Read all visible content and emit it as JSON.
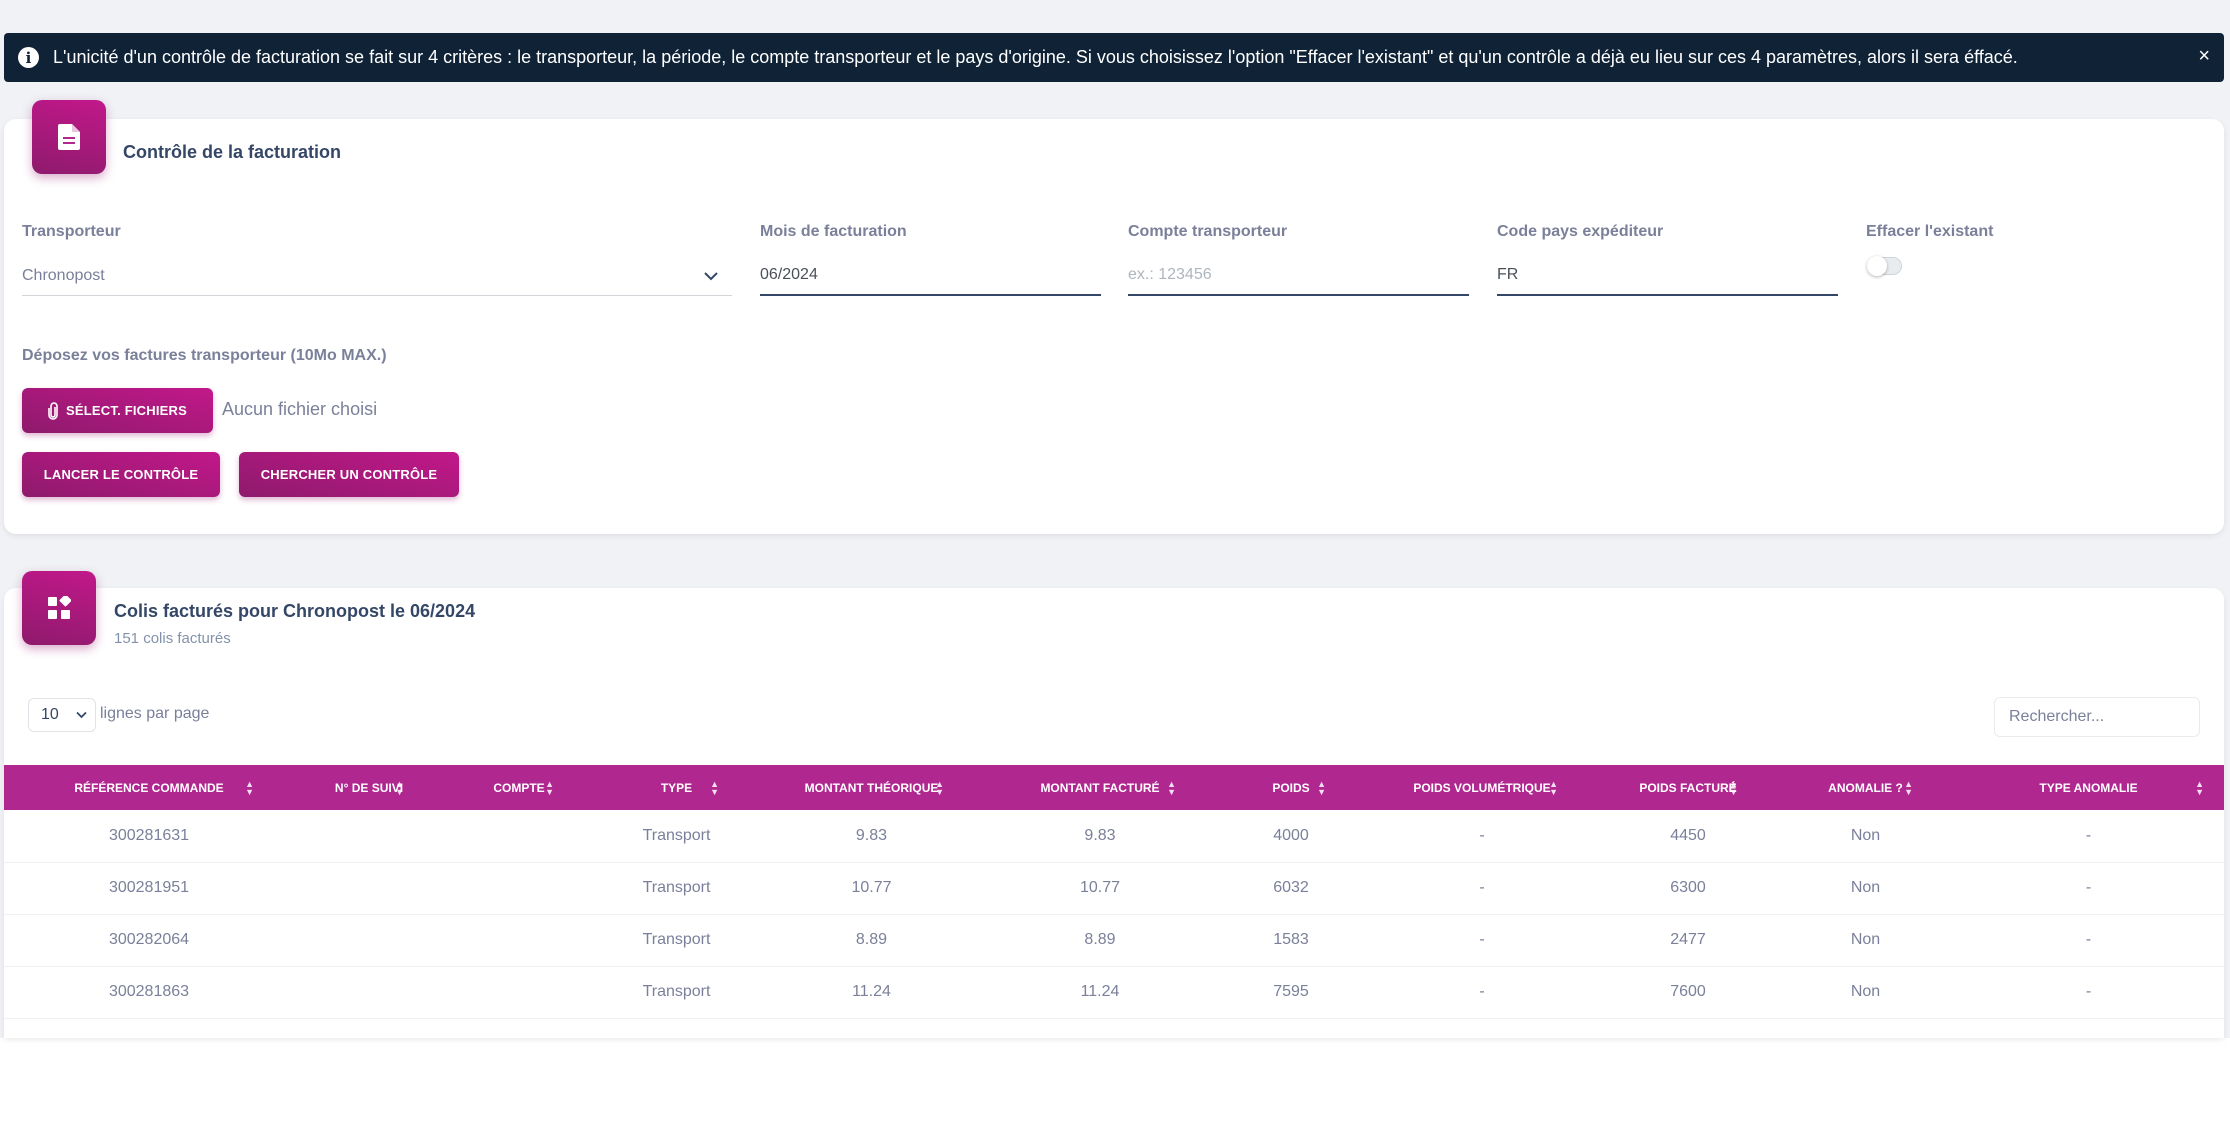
{
  "alert": {
    "text": "L'unicité d'un contrôle de facturation se fait sur 4 critères : le transporteur, la période, le compte transporteur et le pays d'origine. Si vous choisissez l'option \"Effacer l'existant\" et qu'un contrôle a déjà eu lieu sur ces 4 paramètres, alors il sera éffacé.",
    "close": "×"
  },
  "control_card": {
    "title": "Contrôle de la facturation",
    "fields": {
      "transporteur_label": "Transporteur",
      "transporteur_value": "Chronopost",
      "mois_label": "Mois de facturation",
      "mois_value": "06/2024",
      "compte_label": "Compte transporteur",
      "compte_placeholder": "ex.: 123456",
      "pays_label": "Code pays expéditeur",
      "pays_value": "FR",
      "effacer_label": "Effacer l'existant",
      "effacer_on": false
    },
    "upload_label": "Déposez vos factures transporteur (10Mo MAX.)",
    "select_files_button": "SÉLECT. FICHIERS",
    "no_file": "Aucun fichier choisi",
    "launch_button": "LANCER LE CONTRÔLE",
    "search_button": "CHERCHER UN CONTRÔLE"
  },
  "results_card": {
    "title": "Colis facturés pour Chronopost le 06/2024",
    "subtitle": "151 colis facturés",
    "per_page_value": "10",
    "per_page_label": "lignes par page",
    "search_placeholder": "Rechercher...",
    "columns": [
      "RÉFÉRENCE COMMANDE",
      "N° DE SUIVI",
      "COMPTE",
      "TYPE",
      "MONTANT THÉORIQUE",
      "MONTANT FACTURÉ",
      "POIDS",
      "POIDS VOLUMÉTRIQUE",
      "POIDS FACTURÉ",
      "ANOMALIE ?",
      "TYPE ANOMALIE"
    ],
    "rows": [
      [
        "300281631",
        "",
        "",
        "Transport",
        "9.83",
        "9.83",
        "4000",
        "-",
        "4450",
        "Non",
        "-"
      ],
      [
        "300281951",
        "",
        "",
        "Transport",
        "10.77",
        "10.77",
        "6032",
        "-",
        "6300",
        "Non",
        "-"
      ],
      [
        "300282064",
        "",
        "",
        "Transport",
        "8.89",
        "8.89",
        "1583",
        "-",
        "2477",
        "Non",
        "-"
      ],
      [
        "300281863",
        "",
        "",
        "Transport",
        "11.24",
        "11.24",
        "7595",
        "-",
        "7600",
        "Non",
        "-"
      ]
    ]
  },
  "colors": {
    "accent": "#b0288f",
    "alert_bg": "#0f2236",
    "page_bg": "#f0f2f5"
  }
}
